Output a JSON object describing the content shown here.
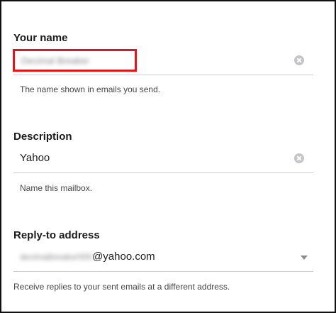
{
  "form": {
    "name": {
      "label": "Your name",
      "value": "Decimal Breaker",
      "helper": "The name shown in emails you send."
    },
    "description": {
      "label": "Description",
      "value": "Yahoo",
      "helper": "Name this mailbox."
    },
    "reply_to": {
      "label": "Reply-to address",
      "local_part": "decimalbreaker000",
      "domain": "@yahoo.com",
      "helper": "Receive replies to your sent emails at a different address."
    }
  },
  "icons": {
    "clear": "clear-circle-x-icon",
    "dropdown": "caret-down-icon"
  },
  "colors": {
    "highlight": "#e0161b",
    "divider": "#cfcfd3",
    "helper_text": "#46464b"
  }
}
